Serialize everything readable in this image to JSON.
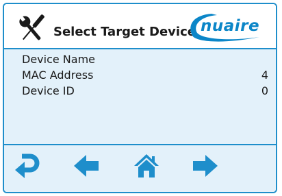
{
  "header": {
    "title": "Select Target Device",
    "brand": "nuaire",
    "tools_icon": "wrench-screwdriver-icon"
  },
  "device": {
    "rows": [
      {
        "label": "Device Name",
        "value": ""
      },
      {
        "label": "MAC Address",
        "value": "4"
      },
      {
        "label": "Device ID",
        "value": "0"
      }
    ]
  },
  "nav": {
    "buttons": [
      {
        "icon": "return-icon"
      },
      {
        "icon": "arrow-left-icon"
      },
      {
        "icon": "home-icon"
      },
      {
        "icon": "arrow-right-icon"
      }
    ]
  },
  "colors": {
    "accent": "#1e8ecb",
    "panel": "#e3f1fa",
    "brand": "#0b86c8"
  }
}
